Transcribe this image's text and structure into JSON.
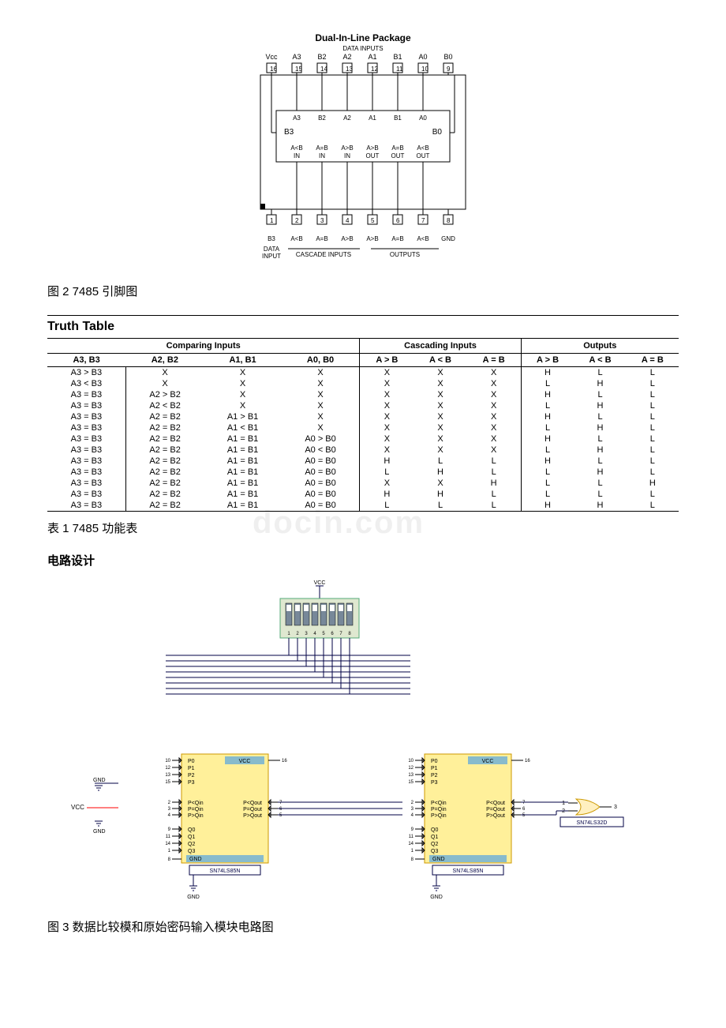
{
  "pinout": {
    "title": "Dual-In-Line Package",
    "subtitle": "DATA INPUTS",
    "top_labels": [
      "Vcc",
      "A3",
      "B2",
      "A2",
      "A1",
      "B1",
      "A0",
      "B0"
    ],
    "top_pins": [
      "16",
      "15",
      "14",
      "13",
      "12",
      "11",
      "10",
      "9"
    ],
    "inner_top": [
      "A3",
      "B2",
      "A2",
      "A1",
      "B1",
      "A0"
    ],
    "inner_left": "B3",
    "inner_right": "B0",
    "inner_bottom_top": [
      "A<B",
      "A=B",
      "A>B",
      "A>B",
      "A=B",
      "A<B"
    ],
    "inner_bottom_sub": [
      "IN",
      "IN",
      "IN",
      "OUT",
      "OUT",
      "OUT"
    ],
    "bottom_pins": [
      "1",
      "2",
      "3",
      "4",
      "5",
      "6",
      "7",
      "8"
    ],
    "bottom_labels": [
      "B3",
      "A<B",
      "A=B",
      "A>B",
      "A>B",
      "A=B",
      "A<B",
      "GND"
    ],
    "bottom_sub_left": [
      "DATA",
      "INPUT"
    ],
    "bottom_group_left": "CASCADE INPUTS",
    "bottom_group_right": "OUTPUTS"
  },
  "fig2_caption": "图 2 7485 引脚图",
  "truth_table": {
    "title": "Truth Table",
    "group_headers": [
      "Comparing Inputs",
      "Cascading Inputs",
      "Outputs"
    ],
    "col_headers": [
      "A3, B3",
      "A2, B2",
      "A1, B1",
      "A0, B0",
      "A > B",
      "A < B",
      "A = B",
      "A > B",
      "A < B",
      "A = B"
    ],
    "rows": [
      [
        "A3 > B3",
        "X",
        "X",
        "X",
        "X",
        "X",
        "X",
        "H",
        "L",
        "L"
      ],
      [
        "A3 < B3",
        "X",
        "X",
        "X",
        "X",
        "X",
        "X",
        "L",
        "H",
        "L"
      ],
      [
        "A3 = B3",
        "A2 > B2",
        "X",
        "X",
        "X",
        "X",
        "X",
        "H",
        "L",
        "L"
      ],
      [
        "A3 = B3",
        "A2 < B2",
        "X",
        "X",
        "X",
        "X",
        "X",
        "L",
        "H",
        "L"
      ],
      [
        "A3 = B3",
        "A2 = B2",
        "A1 > B1",
        "X",
        "X",
        "X",
        "X",
        "H",
        "L",
        "L"
      ],
      [
        "A3 = B3",
        "A2 = B2",
        "A1 < B1",
        "X",
        "X",
        "X",
        "X",
        "L",
        "H",
        "L"
      ],
      [
        "A3 = B3",
        "A2 = B2",
        "A1 = B1",
        "A0 > B0",
        "X",
        "X",
        "X",
        "H",
        "L",
        "L"
      ],
      [
        "A3 = B3",
        "A2 = B2",
        "A1 = B1",
        "A0 < B0",
        "X",
        "X",
        "X",
        "L",
        "H",
        "L"
      ],
      [
        "A3 = B3",
        "A2 = B2",
        "A1 = B1",
        "A0 = B0",
        "H",
        "L",
        "L",
        "H",
        "L",
        "L"
      ],
      [
        "A3 = B3",
        "A2 = B2",
        "A1 = B1",
        "A0 = B0",
        "L",
        "H",
        "L",
        "L",
        "H",
        "L"
      ],
      [
        "A3 = B3",
        "A2 = B2",
        "A1 = B1",
        "A0 = B0",
        "X",
        "X",
        "H",
        "L",
        "L",
        "H"
      ],
      [
        "A3 = B3",
        "A2 = B2",
        "A1 = B1",
        "A0 = B0",
        "H",
        "H",
        "L",
        "L",
        "L",
        "L"
      ],
      [
        "A3 = B3",
        "A2 = B2",
        "A1 = B1",
        "A0 = B0",
        "L",
        "L",
        "L",
        "H",
        "H",
        "L"
      ]
    ]
  },
  "table1_caption": "表 1 7485 功能表",
  "section_heading": "电路设计",
  "circuit": {
    "vcc": "VCC",
    "gnd": "GND",
    "dip_labels": [
      "1",
      "2",
      "3",
      "4",
      "5",
      "6",
      "7",
      "8"
    ],
    "chip": {
      "P": [
        "P0",
        "P1",
        "P2",
        "P3"
      ],
      "cmp_in": [
        "P<Qin",
        "P=Qin",
        "P>Qin"
      ],
      "cmp_out": [
        "P<Qout",
        "P=Qout",
        "P>Qout"
      ],
      "Q": [
        "Q0",
        "Q1",
        "Q2",
        "Q3"
      ],
      "gnd_label": "GND",
      "name": "SN74LS85N",
      "pins_left_p": [
        "10",
        "12",
        "13",
        "15"
      ],
      "pins_left_cmp": [
        "2",
        "3",
        "4"
      ],
      "pins_left_q": [
        "9",
        "11",
        "14",
        "1"
      ],
      "pin_gnd": "8",
      "pin_vcc_out": "16",
      "pins_right_cmp": [
        "7",
        "6",
        "5"
      ],
      "vcc_label": "VCC"
    },
    "gate_name": "SN74LS32D",
    "gate_pins": [
      "1",
      "2",
      "3"
    ]
  },
  "fig3_caption": "图 3 数据比较模和原始密码输入模块电路图",
  "watermark": "docin.com"
}
